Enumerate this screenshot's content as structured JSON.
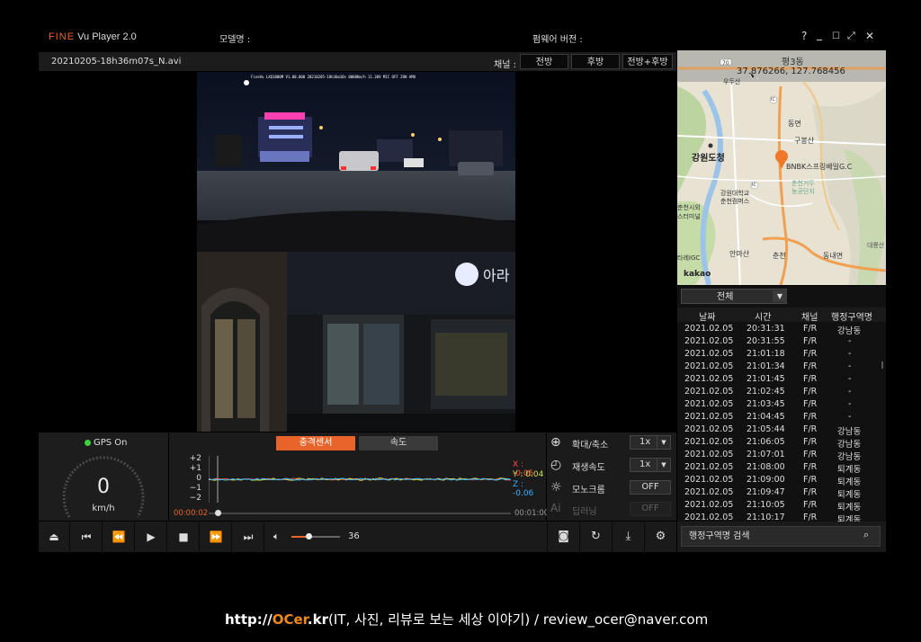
{
  "app": {
    "logo_fine": "FINE",
    "logo_rest": " Vu Player 2.0",
    "model_label": "모델명 :",
    "firmware_label": "펌웨어 버전 :",
    "window_buttons": [
      "?",
      "_",
      "☐",
      "⤢",
      "✕"
    ]
  },
  "filebar": {
    "filename": "20210205-18h36m07s_N.avi",
    "channel_label": "채널 :",
    "channels": [
      "전방",
      "후방",
      "전방+후방"
    ]
  },
  "video": {
    "overlay_text": "FineVu LXQ1000M V1.00.000 20210205-18h36m10s 0000Km/h 11.30V MIC OFF ZOH AMU",
    "sign_text": "아라"
  },
  "map": {
    "place": "평3동",
    "coords": "37.876266, 127.768456",
    "labels": [
      {
        "t": "강원도청"
      },
      {
        "t": "동면"
      },
      {
        "t": "구봉산"
      },
      {
        "t": "BNBK스프링베일G.C"
      },
      {
        "t": "춘천거두"
      },
      {
        "t": "농공단지"
      },
      {
        "t": "강원대학교"
      },
      {
        "t": "춘천캠퍼스"
      },
      {
        "t": "춘천시외"
      },
      {
        "t": "스터미널"
      },
      {
        "t": "안마산"
      },
      {
        "t": "춘천"
      },
      {
        "t": "동내면"
      },
      {
        "t": "대룡산"
      },
      {
        "t": "우두산"
      },
      {
        "t": "타레IGC"
      }
    ],
    "road_badges": [
      "70",
      "IC",
      "IC"
    ],
    "attribution": "kakao"
  },
  "event_list": {
    "filter": "전체",
    "headers": [
      "날짜",
      "시간",
      "채널",
      "행정구역명"
    ],
    "rows": [
      [
        "2021.02.05",
        "20:31:31",
        "F/R",
        "강남동"
      ],
      [
        "2021.02.05",
        "20:31:55",
        "F/R",
        "-"
      ],
      [
        "2021.02.05",
        "21:01:18",
        "F/R",
        "-"
      ],
      [
        "2021.02.05",
        "21:01:34",
        "F/R",
        "-"
      ],
      [
        "2021.02.05",
        "21:01:45",
        "F/R",
        "-"
      ],
      [
        "2021.02.05",
        "21:02:45",
        "F/R",
        "-"
      ],
      [
        "2021.02.05",
        "21:03:45",
        "F/R",
        "-"
      ],
      [
        "2021.02.05",
        "21:04:45",
        "F/R",
        "-"
      ],
      [
        "2021.02.05",
        "21:05:44",
        "F/R",
        "강남동"
      ],
      [
        "2021.02.05",
        "21:06:05",
        "F/R",
        "강남동"
      ],
      [
        "2021.02.05",
        "21:07:01",
        "F/R",
        "강남동"
      ],
      [
        "2021.02.05",
        "21:08:00",
        "F/R",
        "퇴계동"
      ],
      [
        "2021.02.05",
        "21:09:00",
        "F/R",
        "퇴계동"
      ],
      [
        "2021.02.05",
        "21:09:47",
        "F/R",
        "퇴계동"
      ],
      [
        "2021.02.05",
        "21:10:05",
        "F/R",
        "퇴계동"
      ],
      [
        "2021.02.05",
        "21:10:17",
        "F/R",
        "퇴계동"
      ]
    ]
  },
  "speed": {
    "gps_label": "GPS On",
    "value": "0",
    "unit": "km/h"
  },
  "graph": {
    "tabs": [
      "충격센서",
      "속도"
    ],
    "y_labels": [
      "+2",
      "+1",
      "0",
      "−1",
      "−2"
    ],
    "x_reading": "X : -0.05",
    "y_reading": "Y : 0.04",
    "z_reading": "Z : -0.06",
    "time_current": "00:00:02",
    "time_total": "00:01:00",
    "progress": 0.03
  },
  "settings": {
    "zoom_label": "확대/축소",
    "zoom_value": "1x",
    "speed_label": "재생속도",
    "speed_value": "1x",
    "mono_label": "모노크롬",
    "mono_value": "OFF",
    "deep_label": "딥러닝",
    "deep_value": "OFF"
  },
  "playback": {
    "volume": "36",
    "volume_level": 0.36
  },
  "search": {
    "placeholder": "행정구역명 검색"
  },
  "watermark": {
    "http": "http://",
    "ocer": "OCer",
    "kr": ".kr",
    "rest": "(IT, 사진, 리뷰로 보는 세상 이야기) / review_ocer@naver.com"
  },
  "colors": {
    "accent": "#e8642b",
    "gps": "#3fd23f",
    "x_axis": "#ff5040",
    "y_axis": "#d0e040",
    "z_axis": "#3ab0ff"
  }
}
